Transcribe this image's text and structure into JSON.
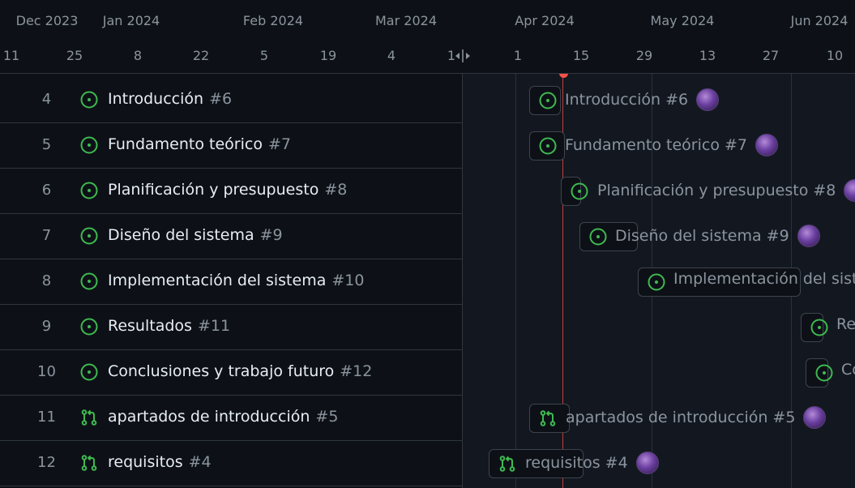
{
  "header": {
    "months": [
      "Dec 2023",
      "Jan 2024",
      "Feb 2024",
      "Mar 2024",
      "Apr 2024",
      "May 2024",
      "Jun 2024"
    ],
    "days": [
      "11",
      "25",
      "8",
      "22",
      "5",
      "19",
      "4",
      "1",
      "1",
      "15",
      "29",
      "13",
      "27",
      "10"
    ]
  },
  "rows": [
    {
      "num": "4",
      "title": "Introducción",
      "ref": "#6",
      "type": "issue-open"
    },
    {
      "num": "5",
      "title": "Fundamento teórico",
      "ref": "#7",
      "type": "issue-open"
    },
    {
      "num": "6",
      "title": "Planificación y presupuesto",
      "ref": "#8",
      "type": "issue-open"
    },
    {
      "num": "7",
      "title": "Diseño del sistema",
      "ref": "#9",
      "type": "issue-open"
    },
    {
      "num": "8",
      "title": "Implementación del sistema",
      "ref": "#10",
      "type": "issue-open"
    },
    {
      "num": "9",
      "title": "Resultados",
      "ref": "#11",
      "type": "issue-open"
    },
    {
      "num": "10",
      "title": "Conclusiones y trabajo futuro",
      "ref": "#12",
      "type": "issue-open"
    },
    {
      "num": "11",
      "title": "apartados de introducción",
      "ref": "#5",
      "type": "pull-request"
    },
    {
      "num": "12",
      "title": "requisitos",
      "ref": "#4",
      "type": "pull-request"
    }
  ],
  "timeline_labels": [
    "Introducción #6",
    "Fundamento teórico #7",
    "Planificación y presupuesto #8",
    "Diseño del sistema #9",
    "Implementación del sistema",
    "Re",
    "Co",
    "apartados de introducción #5",
    "requisitos #4"
  ],
  "colors": {
    "background": "#0d1117",
    "open_green": "#3fb950",
    "today_marker": "#f85149",
    "muted_text": "#8b949e"
  },
  "icons": {
    "issue-open": "issue-opened-icon",
    "pull-request": "git-pull-request-icon",
    "resize": "resize-handle-icon"
  }
}
